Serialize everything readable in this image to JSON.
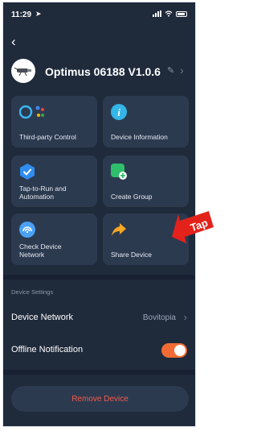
{
  "status_bar": {
    "time": "11:29"
  },
  "header": {
    "device_name": "Optimus 06188 V1.0.6"
  },
  "tiles": [
    {
      "label": "Third-party Control"
    },
    {
      "label": "Device Information"
    },
    {
      "label": "Tap-to-Run and Automation"
    },
    {
      "label": "Create Group"
    },
    {
      "label": "Check Device Network"
    },
    {
      "label": "Share Device"
    }
  ],
  "settings": {
    "section_label": "Device Settings",
    "device_network_label": "Device Network",
    "device_network_value": "Bovitopia",
    "offline_notification_label": "Offline Notification",
    "offline_notification_on": true
  },
  "remove_button": "Remove Device",
  "annotation": {
    "text": "Tap",
    "color": "#e3221b"
  }
}
